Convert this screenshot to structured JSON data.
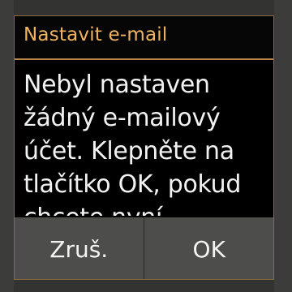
{
  "dialog": {
    "title": "Nastavit e-mail",
    "message_lines": [
      "Nebyl nastaven",
      "žádný e-mailový",
      "účet. Klepněte na",
      "tlačítko OK, pokud",
      "chcete nyní"
    ],
    "buttons": {
      "cancel": "Zruš.",
      "ok": "OK"
    }
  },
  "colors": {
    "title": "#f0b460",
    "accent_line": "#b9864b",
    "background": "#000000",
    "button_bar": "#4d4d4b",
    "text": "#f2f2f2"
  }
}
